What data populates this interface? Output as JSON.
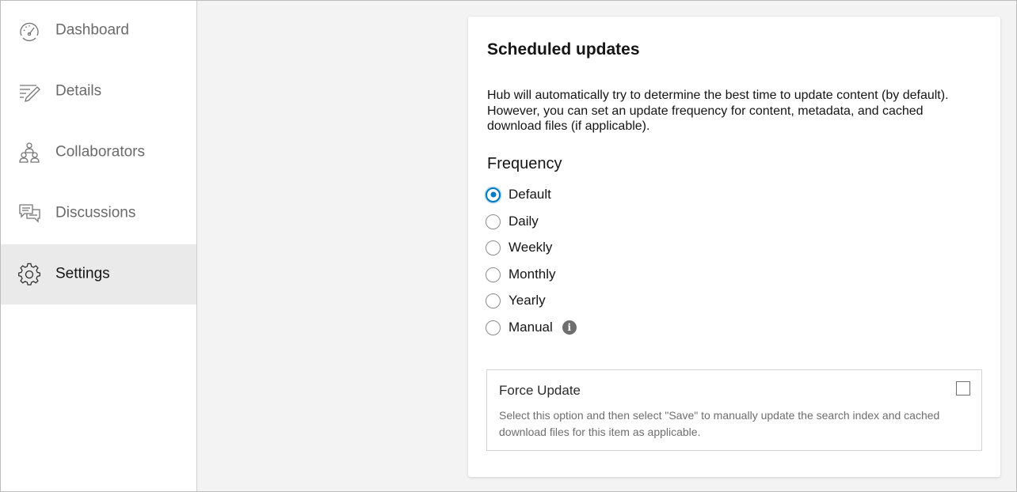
{
  "sidebar": {
    "items": [
      {
        "label": "Dashboard",
        "icon": "dashboard-gauge-icon"
      },
      {
        "label": "Details",
        "icon": "details-pen-icon"
      },
      {
        "label": "Collaborators",
        "icon": "collaborators-people-icon"
      },
      {
        "label": "Discussions",
        "icon": "discussions-speech-icon"
      },
      {
        "label": "Settings",
        "icon": "settings-gear-icon",
        "active": true
      }
    ]
  },
  "card": {
    "title": "Scheduled updates",
    "description": "Hub will automatically try to determine the best time to update content (by default). However, you can set an update frequency for content, metadata, and cached download files (if applicable).",
    "frequency_label": "Frequency",
    "options": [
      {
        "label": "Default",
        "checked": true
      },
      {
        "label": "Daily",
        "checked": false
      },
      {
        "label": "Weekly",
        "checked": false
      },
      {
        "label": "Monthly",
        "checked": false
      },
      {
        "label": "Yearly",
        "checked": false
      },
      {
        "label": "Manual",
        "checked": false,
        "info_icon": "info-icon"
      }
    ],
    "force_update": {
      "title": "Force Update",
      "checked": false,
      "description": "Select this option and then select \"Save\" to manually update the search index and cached download files for this item as applicable."
    }
  },
  "colors": {
    "accent": "#007ac2",
    "sidebar_active_bg": "#eaeaea",
    "page_bg": "#f3f3f3"
  }
}
